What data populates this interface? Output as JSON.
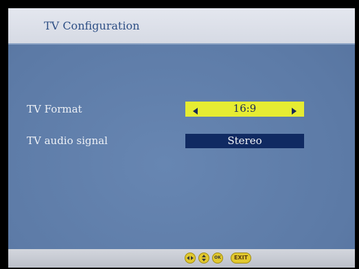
{
  "header": {
    "title": "TV Configuration"
  },
  "settings": {
    "tv_format": {
      "label": "TV Format",
      "value": "16:9"
    },
    "tv_audio_signal": {
      "label": "TV audio signal",
      "value": "Stereo"
    }
  },
  "footer": {
    "ok_label": "OK",
    "exit_label": "EXIT"
  },
  "colors": {
    "background": "#5f7eaa",
    "header": "#dde1ea",
    "header_text": "#2e4f85",
    "highlight": "#e6ec32",
    "field": "#102a62",
    "footer_button": "#e2c92e"
  },
  "icons": {
    "left_arrow": "triangle-left-icon",
    "right_arrow": "triangle-right-icon",
    "nav_left_right": "left-right-nav-icon",
    "nav_up_down": "up-down-nav-icon"
  }
}
